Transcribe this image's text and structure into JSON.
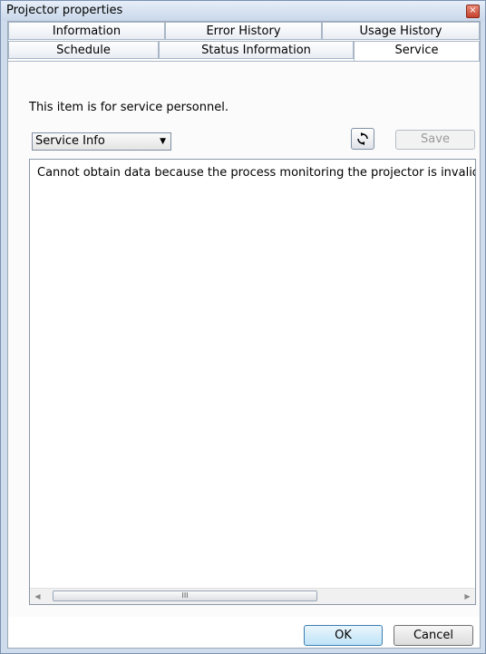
{
  "window": {
    "title": "Projector properties",
    "close_glyph": "×"
  },
  "tabs": {
    "row1": [
      {
        "label": "Information"
      },
      {
        "label": "Error History"
      },
      {
        "label": "Usage History"
      }
    ],
    "row2": [
      {
        "label": "Schedule"
      },
      {
        "label": "Status Information"
      },
      {
        "label": "Service",
        "active": true
      }
    ]
  },
  "service": {
    "note": "This item is for service personnel.",
    "combo_value": "Service Info",
    "refresh_icon": "refresh-icon",
    "save_label": "Save",
    "message": "Cannot obtain data because the process monitoring the projector is invalid"
  },
  "scrollbar": {
    "left_arrow": "◀",
    "right_arrow": "▶",
    "thumb_grip": "III"
  },
  "footer": {
    "ok_label": "OK",
    "cancel_label": "Cancel"
  }
}
